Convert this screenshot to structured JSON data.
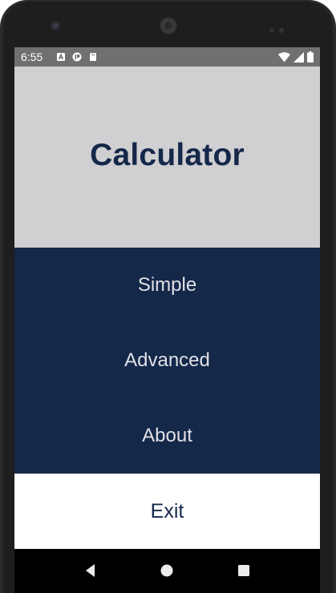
{
  "status_bar": {
    "time": "6:55"
  },
  "app": {
    "title": "Calculator"
  },
  "menu": {
    "items": [
      {
        "label": "Simple"
      },
      {
        "label": "Advanced"
      },
      {
        "label": "About"
      }
    ],
    "exit_label": "Exit"
  },
  "colors": {
    "header_bg": "#d0cfd1",
    "title_color": "#15284b",
    "menu_bg": "#142849",
    "menu_text": "#e0e0e6",
    "exit_bg": "#ffffff",
    "status_bar_bg": "#707070"
  },
  "icons": {
    "status_left": [
      "a-notification-icon",
      "app-notification-icon",
      "sd-card-icon"
    ],
    "status_right": [
      "wifi-icon",
      "cellular-signal-icon",
      "battery-icon"
    ],
    "nav": [
      "back-icon",
      "home-icon",
      "recents-icon"
    ]
  }
}
